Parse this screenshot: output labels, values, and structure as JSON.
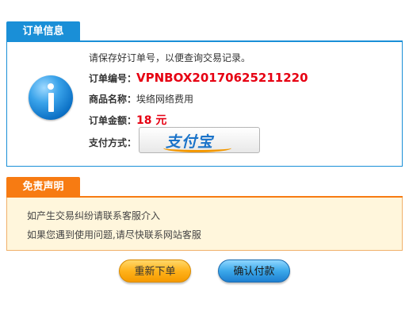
{
  "order_section": {
    "tab_label": "订单信息",
    "notice": "请保存好订单号，以便查询交易记录。",
    "order_no_label": "订单编号：",
    "order_no": "VPNBOX20170625211220",
    "product_label": "商品名称：",
    "product_name": "埃络网络费用",
    "amount_label": "订单金额：",
    "amount": "18 元",
    "payment_label": "支付方式：",
    "payment_method_logo": "支付宝",
    "icon": "info-icon"
  },
  "disclaimer_section": {
    "tab_label": "免责声明",
    "lines": [
      "如产生交易纠纷请联系客服介入",
      "如果您遇到使用问题,请尽快联系网站客服"
    ]
  },
  "actions": {
    "reorder_label": "重新下单",
    "confirm_label": "确认付款"
  },
  "colors": {
    "order_accent": "#1a8fd7",
    "disclaimer_accent": "#f77b12",
    "highlight_red": "#e60012",
    "disclaimer_bg": "#fff6dc"
  }
}
